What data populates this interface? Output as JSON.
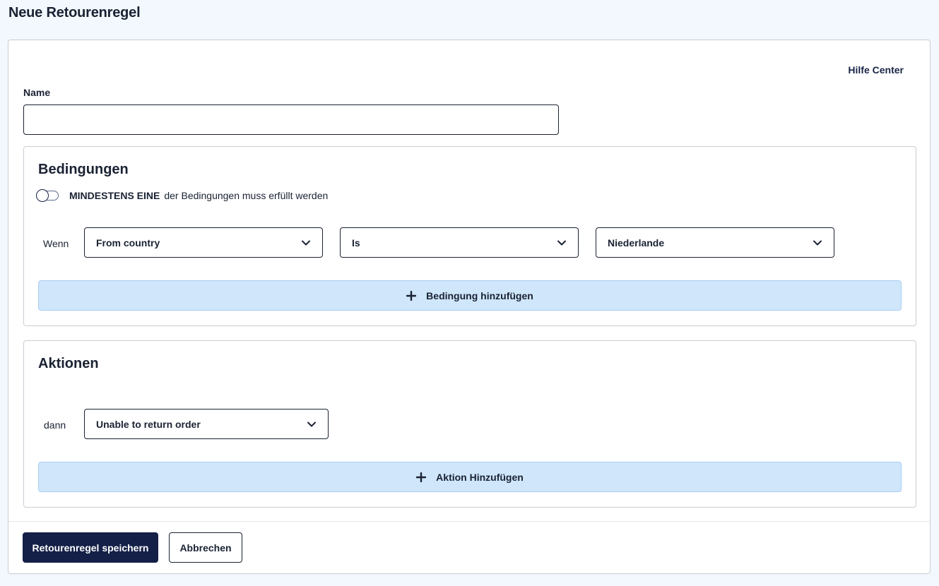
{
  "page": {
    "title": "Neue Retourenregel"
  },
  "help": {
    "label": "Hilfe Center"
  },
  "name_field": {
    "label": "Name",
    "value": "",
    "placeholder": ""
  },
  "conditions": {
    "title": "Bedingungen",
    "toggle": {
      "strong": "MINDESTENS EINE",
      "text": "der Bedingungen muss erfüllt werden",
      "on": false
    },
    "rows": [
      {
        "label": "Wenn",
        "field": "From country",
        "operator": "Is",
        "value": "Niederlande"
      }
    ],
    "add_label": "Bedingung hinzufügen"
  },
  "actions": {
    "title": "Aktionen",
    "rows": [
      {
        "label": "dann",
        "action": "Unable to return order"
      }
    ],
    "add_label": "Aktion Hinzufügen"
  },
  "footer": {
    "save_label": "Retourenregel speichern",
    "cancel_label": "Abbrechen"
  },
  "colors": {
    "primary": "#142047",
    "add_bar": "#cfe6fb",
    "page_bg": "#f2f8fd"
  }
}
